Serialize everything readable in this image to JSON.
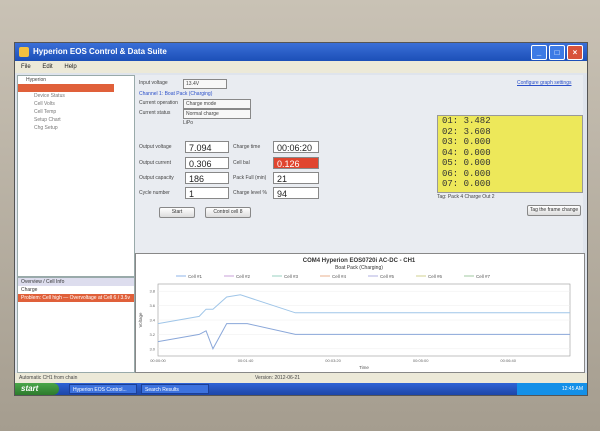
{
  "window": {
    "title": "Hyperion EOS Control & Data Suite"
  },
  "menu": [
    "File",
    "Edit",
    "Help"
  ],
  "tree": {
    "root": "Hyperion",
    "items": [
      "",
      "Device Status",
      "Cell Volts",
      "Cell Temp",
      "Setup Chart",
      "Chg Setup"
    ],
    "selected_index": 0
  },
  "event_log": {
    "header": "Overview / Cell Info",
    "items": [
      "Charge",
      "Problem: Cell high — Overvoltage at Cell 6 / 3.5v"
    ]
  },
  "fields": {
    "input_voltage_label": "Input voltage",
    "input_voltage_value": "13.4V",
    "channel_label": "Channel 1: Boat Pack (Charging)",
    "current_operation_label": "Current operation",
    "current_operation_value": "Charge mode",
    "current_status_label": "Current status",
    "current_status_value": "Normal charge",
    "chem_value": "LiPo"
  },
  "readings": {
    "output_voltage_label": "Output voltage",
    "output_voltage": "7.094",
    "charge_time_label": "Charge time",
    "charge_time": "00:06:20",
    "output_current_label": "Output current",
    "output_current": "0.306",
    "cell_bal_label": "Cell bal",
    "cell_bal": "0.126",
    "output_capacity_label": "Output capacity",
    "output_capacity": "186",
    "pack_full_label": "Pack Full (min)",
    "pack_full": "21",
    "cycle_number_label": "Cycle number",
    "cycle_number": "1",
    "charge_level_label": "Charge level %",
    "charge_level": "94"
  },
  "buttons": {
    "start": "Start",
    "control_cell": "Control cell 8",
    "tag_the_frame": "Tag the frame change"
  },
  "links": {
    "configure": "Configure graph settings"
  },
  "cells": [
    "01: 3.482",
    "02: 3.608",
    "03: 0.000",
    "04: 0.000",
    "05: 0.000",
    "06: 0.000",
    "07: 0.000"
  ],
  "cells_footer": "Tag: Pack 4 Charge Out 2",
  "colors": {
    "cell_panel": "#ede85a",
    "alert": "#e0452f",
    "titlebar": "#1c4fb7"
  },
  "chart_data": {
    "type": "line",
    "title": "COM4 Hyperion EOS0720i AC-DC - CH1",
    "subtitle": "Boat Pack (Charging)",
    "xlabel": "Time",
    "ylabel": "Voltage",
    "series_names": [
      "Cell #1",
      "Cell #2",
      "Cell #3",
      "Cell #4",
      "Cell #5",
      "Cell #6",
      "Cell #7"
    ],
    "x_ticks": [
      "00:00:00",
      "00:01:40",
      "00:03:20",
      "00:05:00",
      "00:06:40"
    ],
    "y_ticks": [
      "3.8",
      "3.6",
      "3.4",
      "3.2",
      "3.0"
    ],
    "ylim": [
      2.9,
      3.9
    ],
    "series": [
      {
        "name": "Cell #1",
        "x": [
          0,
          60,
          70,
          80,
          100,
          120,
          200,
          500,
          600
        ],
        "y": [
          3.35,
          3.45,
          3.55,
          3.55,
          3.72,
          3.75,
          3.5,
          3.5,
          3.5
        ]
      },
      {
        "name": "Cell #2",
        "x": [
          0,
          60,
          70,
          80,
          100,
          130,
          200,
          500,
          600
        ],
        "y": [
          3.1,
          3.2,
          3.25,
          3.0,
          3.35,
          3.35,
          3.2,
          3.2,
          3.2
        ]
      }
    ]
  },
  "status": {
    "left": "Automatic CH1 from chain",
    "center": "Version: 2012-06-21"
  },
  "taskbar": {
    "start": "start",
    "tasks": [
      "Hyperion EOS Control...",
      "Search Results"
    ],
    "clock": "12:45 AM"
  }
}
